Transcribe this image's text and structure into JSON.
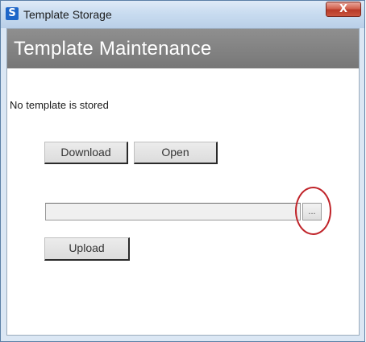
{
  "window": {
    "title": "Template Storage",
    "app_icon_glyph": "S",
    "close_glyph": "X",
    "accent_color": "#d84b3c"
  },
  "header": {
    "title": "Template Maintenance",
    "band_color": "#808080"
  },
  "status": {
    "text": "No template is stored"
  },
  "buttons": {
    "download_label": "Download",
    "open_label": "Open",
    "browse_label": "...",
    "upload_label": "Upload"
  },
  "file_path": {
    "value": ""
  },
  "annotation": {
    "ring_color": "#c0242a"
  }
}
